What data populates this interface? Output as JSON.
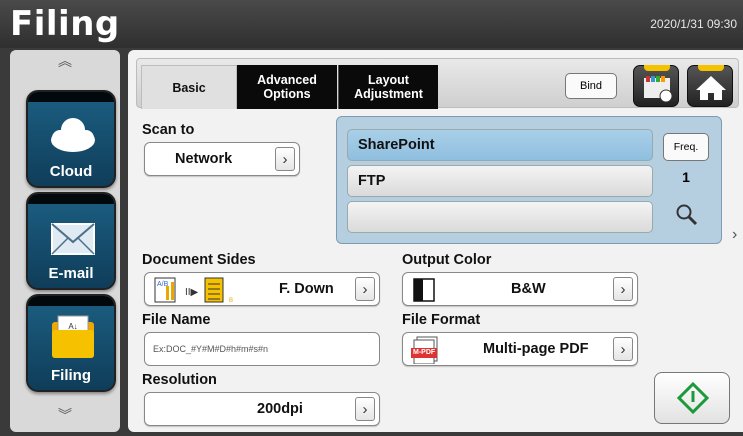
{
  "app": {
    "title": "Filing",
    "datetime": "2020/1/31 09:30"
  },
  "sidebar": {
    "scroll_up_icon": "chevron-up-icon",
    "scroll_down_icon": "chevron-down-icon",
    "items": [
      {
        "label": "Cloud",
        "icon": "cloud-icon"
      },
      {
        "label": "E-mail",
        "icon": "envelope-icon"
      },
      {
        "label": "Filing",
        "icon": "folder-icon"
      }
    ]
  },
  "tabs": [
    {
      "label": "Basic",
      "active": true
    },
    {
      "label": "Advanced Options",
      "active": false
    },
    {
      "label": "Layout Adjustment",
      "active": false
    }
  ],
  "toolbar": {
    "bind_label": "Bind",
    "profile_icon": "scan-profile-icon",
    "home_icon": "home-icon"
  },
  "scan_to": {
    "label": "Scan to",
    "value": "Network",
    "destinations": [
      "SharePoint",
      "FTP",
      ""
    ],
    "freq_label": "Freq.",
    "count": "1",
    "search_icon": "magnifier-icon"
  },
  "document_sides": {
    "label": "Document Sides",
    "value": "F. Down"
  },
  "output_color": {
    "label": "Output Color",
    "value": "B&W"
  },
  "file_name": {
    "label": "File Name",
    "placeholder": "Ex:DOC_#Y#M#D#h#m#s#n"
  },
  "file_format": {
    "label": "File Format",
    "value": "Multi-page PDF",
    "badge": "M-PDF"
  },
  "resolution": {
    "label": "Resolution",
    "value": "200dpi"
  },
  "start_icon": "diamond-start-icon",
  "colors": {
    "selected": "#a9cfe8",
    "accent_green": "#1a9a3a",
    "dark": "#0a0a0a",
    "yellow": "#f6c200"
  }
}
